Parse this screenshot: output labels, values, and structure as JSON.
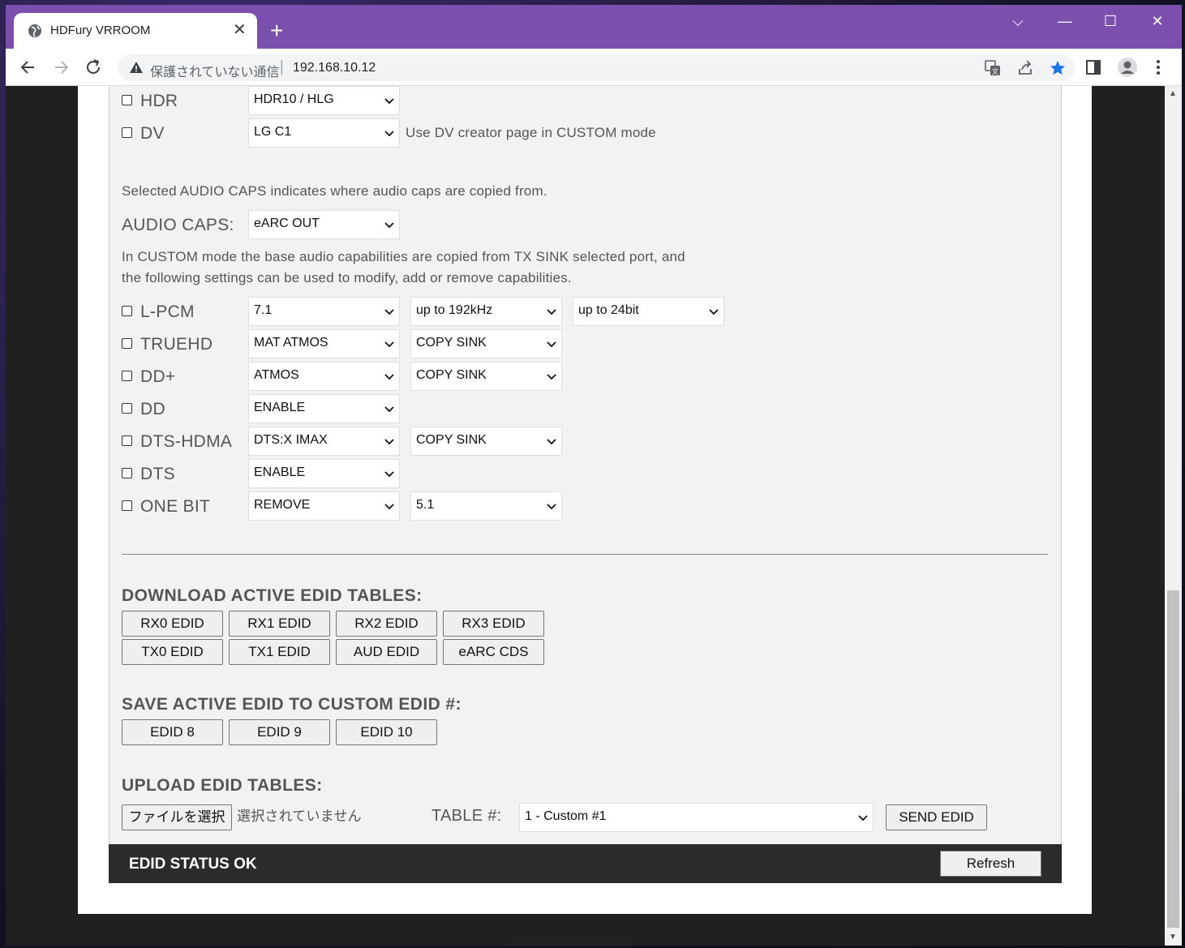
{
  "browser": {
    "tab_title": "HDFury VRROOM",
    "new_tab": "+",
    "omnibox_security": "保護されていない通信",
    "omnibox_separator": "|",
    "url": "192.168.10.12",
    "window_controls": {
      "menu": "⌵",
      "minimize": "—",
      "maximize": "☐",
      "close": "✕"
    }
  },
  "video": {
    "hdr": {
      "label": "HDR",
      "value": "HDR10 / HLG"
    },
    "dv": {
      "label": "DV",
      "value": "LG C1",
      "note": "Use DV creator page in CUSTOM mode"
    }
  },
  "audio": {
    "caps_note": "Selected AUDIO CAPS indicates where audio caps are copied from.",
    "caps_label": "AUDIO CAPS:",
    "caps_value": "eARC OUT",
    "custom_note_1": "In CUSTOM mode the base audio capabilities are copied from TX SINK selected port, and",
    "custom_note_2": "the following settings can be used to modify, add or remove capabilities.",
    "rows": [
      {
        "label": "L-PCM",
        "sel1": "7.1",
        "sel2": "up to 192kHz",
        "sel3": "up to 24bit"
      },
      {
        "label": "TRUEHD",
        "sel1": "MAT ATMOS",
        "sel2": "COPY SINK"
      },
      {
        "label": "DD+",
        "sel1": "ATMOS",
        "sel2": "COPY SINK"
      },
      {
        "label": "DD",
        "sel1": "ENABLE"
      },
      {
        "label": "DTS-HDMA",
        "sel1": "DTS:X IMAX",
        "sel2": "COPY SINK"
      },
      {
        "label": "DTS",
        "sel1": "ENABLE"
      },
      {
        "label": "ONE BIT",
        "sel1": "REMOVE",
        "sel2": "5.1"
      }
    ]
  },
  "download": {
    "title": "DOWNLOAD ACTIVE EDID TABLES:",
    "buttons": [
      "RX0 EDID",
      "RX1 EDID",
      "RX2 EDID",
      "RX3 EDID",
      "TX0 EDID",
      "TX1 EDID",
      "AUD EDID",
      "eARC CDS"
    ]
  },
  "save": {
    "title": "SAVE ACTIVE EDID TO CUSTOM EDID #:",
    "buttons": [
      "EDID 8",
      "EDID 9",
      "EDID 10"
    ]
  },
  "upload": {
    "title": "UPLOAD EDID TABLES:",
    "file_button": "ファイルを選択",
    "file_status": "選択されていません",
    "table_label": "TABLE #:",
    "table_value": "1 - Custom #1",
    "send_button": "SEND EDID"
  },
  "status": {
    "text": "EDID STATUS OK",
    "refresh": "Refresh"
  },
  "colors": {
    "browser_frame": "#7a4fad",
    "status_bar": "#2b2b2b",
    "panel": "#f2f1f4",
    "star": "#1a73e8"
  }
}
